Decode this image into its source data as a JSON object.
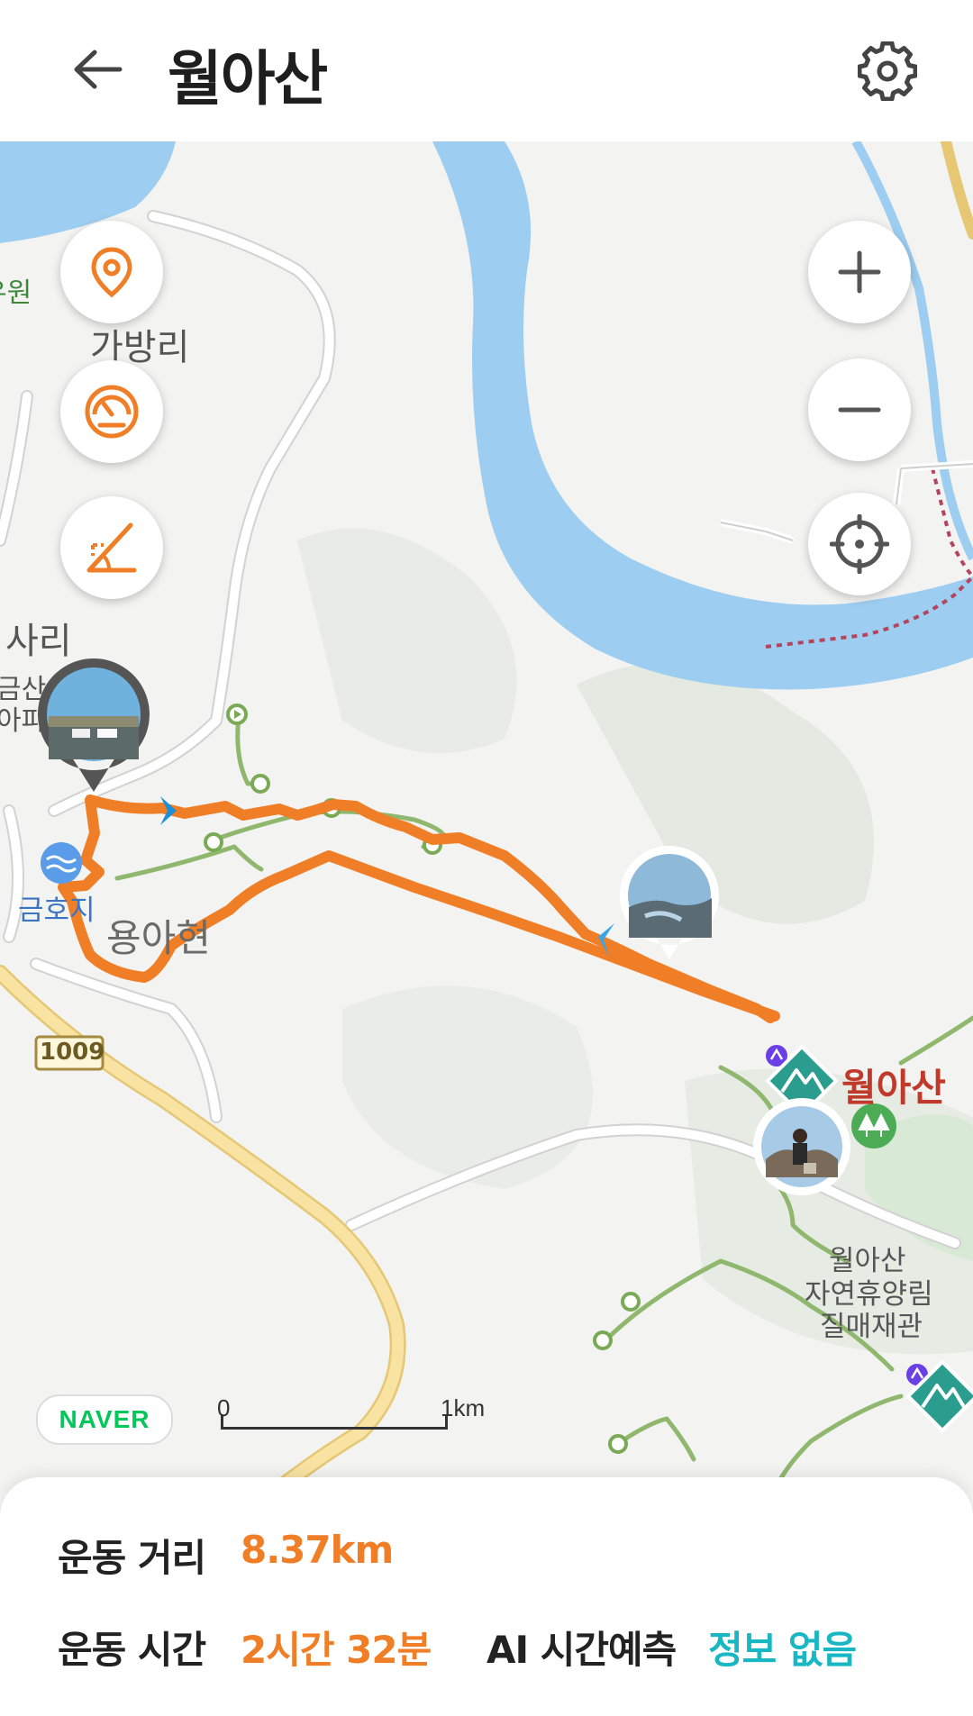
{
  "header": {
    "title": "월아산",
    "back_icon": "arrow-left-icon",
    "settings_icon": "gear-icon"
  },
  "map": {
    "place_labels": {
      "garden_fragment": "유원",
      "gabang_ri": "가방리",
      "sari": "사리",
      "geumsan": "금산",
      "apt_fragment": "아파",
      "geumhoji": "금호지",
      "yongahyeon": "용아현",
      "road_number": "1009",
      "wolasan": "월아산",
      "forest_line1": "월아산",
      "forest_line2": "자연휴양림",
      "forest_line3": "질매재관"
    },
    "left_controls": [
      {
        "name": "location-pin-button",
        "icon": "location-pin-icon"
      },
      {
        "name": "speedometer-button",
        "icon": "speedometer-icon"
      },
      {
        "name": "elevation-slope-button",
        "icon": "slope-icon"
      }
    ],
    "right_controls": [
      {
        "name": "zoom-in-button",
        "icon": "plus-icon"
      },
      {
        "name": "zoom-out-button",
        "icon": "minus-icon"
      },
      {
        "name": "my-location-button",
        "icon": "crosshair-icon"
      }
    ],
    "brand": "NAVER",
    "scale": {
      "start": "0",
      "end": "1km"
    },
    "colors": {
      "route": "#f07e26",
      "water": "#9dcdf0",
      "trail": "#8fb86e",
      "road": "#f4d98a",
      "mountain_marker": "#2a9d8f"
    }
  },
  "stats": {
    "distance_label": "운동 거리",
    "distance_value": "8.37km",
    "time_label": "운동 시간",
    "time_value": "2시간 32분",
    "ai_label": "AI 시간예측",
    "ai_value": "정보 없음"
  }
}
